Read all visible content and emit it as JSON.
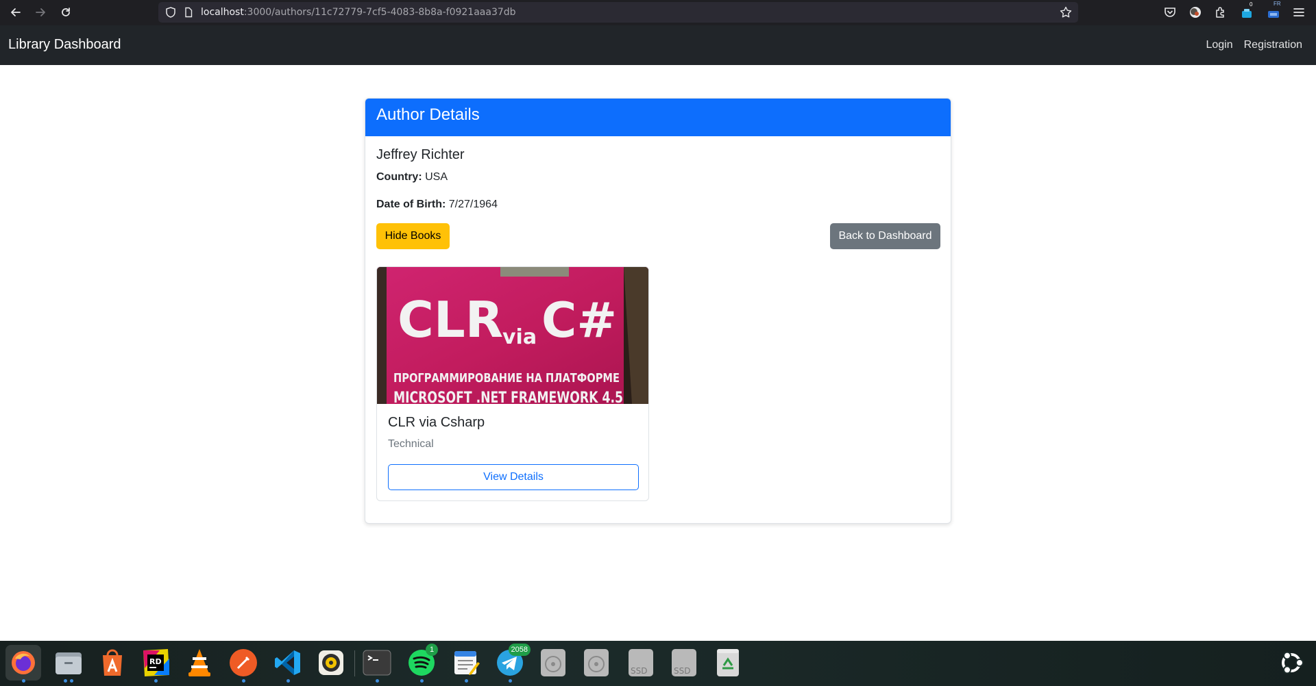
{
  "browser": {
    "url_host": "localhost",
    "url_path": ":3000/authors/11c72779-7cf5-4083-8b8a-f0921aaa37db",
    "badges": {
      "extension_count": "0",
      "lang": "FR"
    }
  },
  "navbar": {
    "brand": "Library Dashboard",
    "links": [
      "Login",
      "Registration"
    ]
  },
  "card": {
    "header": "Author Details",
    "author": {
      "name": "Jeffrey Richter",
      "country_label": "Country:",
      "country": "USA",
      "dob_label": "Date of Birth:",
      "dob": "7/27/1964"
    },
    "buttons": {
      "toggle_books": "Hide Books",
      "back": "Back to Dashboard"
    },
    "books": [
      {
        "title": "CLR via Csharp",
        "genre": "Technical",
        "action": "View Details",
        "cover_text": {
          "line1": "CLR",
          "via": "via",
          "csharp": "C#",
          "line2": "ПРОГРАММИРОВАНИЕ НА ПЛАТФОРМЕ",
          "line3": "MICROSOFT .NET FRAMEWORK 4.5"
        }
      }
    ]
  },
  "taskbar": {
    "apps": [
      "firefox",
      "files",
      "app-center",
      "rider",
      "vlc",
      "postman",
      "vscode",
      "rhythmbox",
      "terminal",
      "spotify",
      "text-editor",
      "telegram",
      "disc-1",
      "disc-2",
      "ssd-1",
      "ssd-2",
      "trash"
    ],
    "spotify_badge": "1",
    "telegram_badge": "2058",
    "ssd_label": "SSD"
  },
  "colors": {
    "primary": "#0d6efd",
    "warning": "#ffc107",
    "secondary": "#6c757d",
    "navbar": "#212529"
  }
}
